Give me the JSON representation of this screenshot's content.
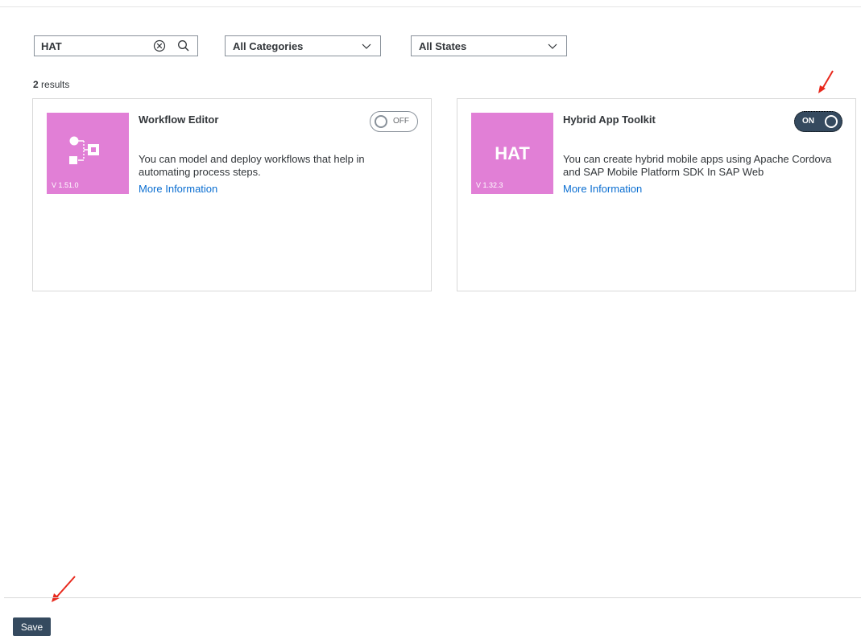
{
  "search": {
    "value": "HAT",
    "clear_icon": "clear-icon",
    "search_icon": "search-icon"
  },
  "filters": {
    "category": {
      "selected": "All Categories"
    },
    "state": {
      "selected": "All States"
    }
  },
  "results": {
    "count": "2",
    "suffix": "results"
  },
  "cards": [
    {
      "title": "Workflow Editor",
      "tile_icon": "workflow-icon",
      "version": "V 1.51.0",
      "description": "You can model and deploy workflows that help in automating process steps.",
      "link": "More Information",
      "toggle_label": "OFF",
      "tile_color": "#e17fd6"
    },
    {
      "title": "Hybrid App Toolkit",
      "tile_text": "HAT",
      "version": "V 1.32.3",
      "description": "You can create hybrid mobile apps using Apache Cordova and SAP Mobile Platform SDK In SAP Web",
      "link": "More Information",
      "toggle_label": "ON",
      "tile_color": "#e17fd6"
    }
  ],
  "footer": {
    "save_label": "Save"
  },
  "colors": {
    "accent": "#354a5f",
    "link": "#0a6ed1",
    "annotation": "#e8281c"
  }
}
